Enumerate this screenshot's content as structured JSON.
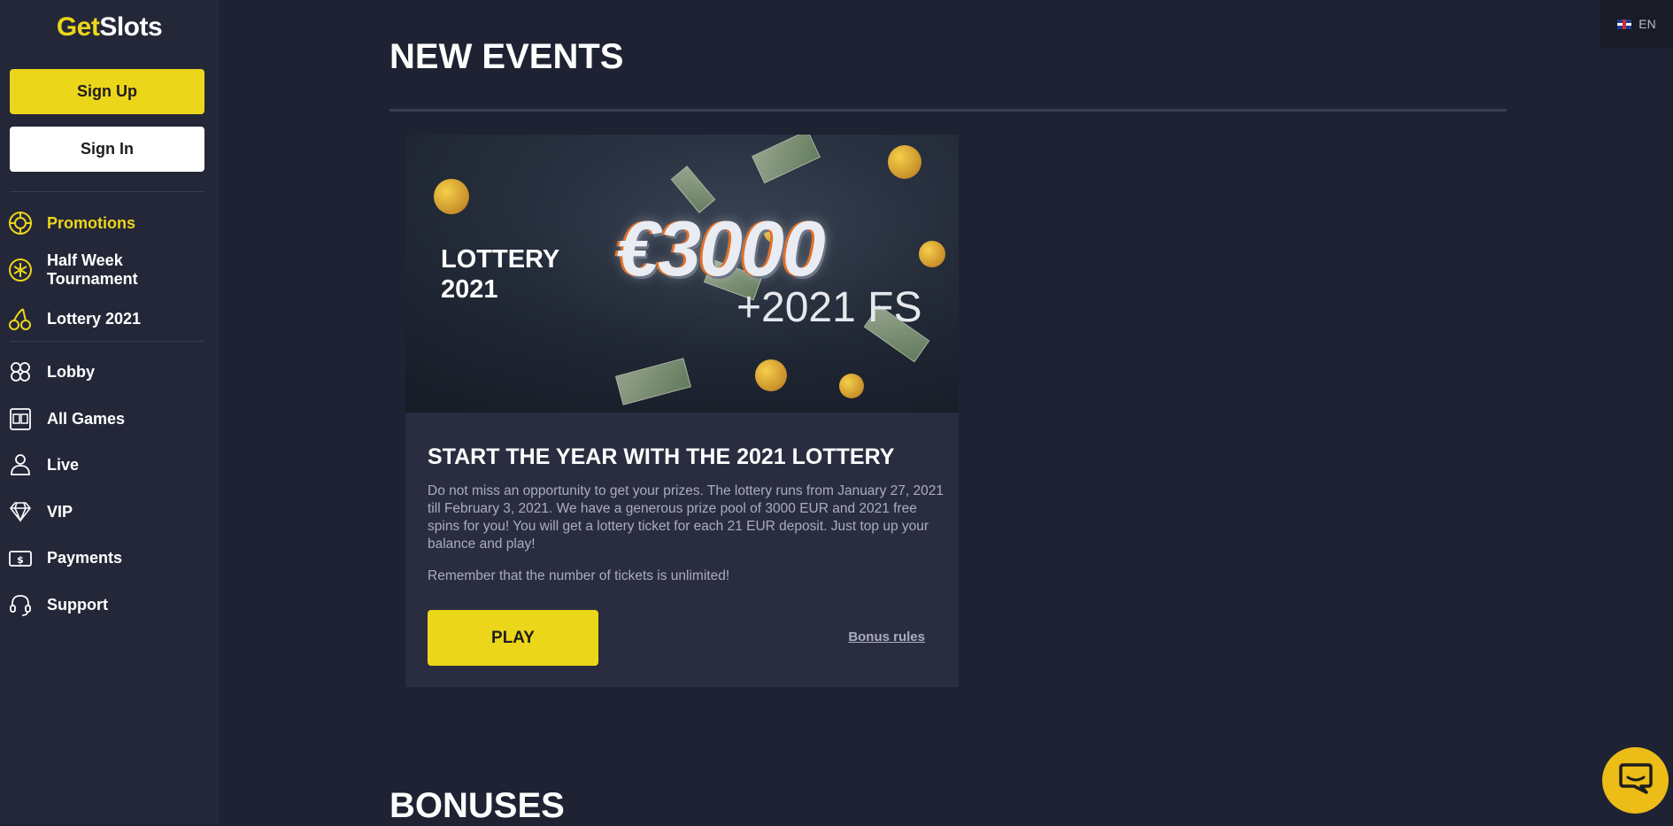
{
  "brand": {
    "part1": "Get",
    "part2": "Slots",
    "accent": "#ecd61a"
  },
  "auth": {
    "signup_label": "Sign Up",
    "signin_label": "Sign In"
  },
  "sidebar": {
    "promo_items": [
      {
        "label": "Promotions",
        "icon": "target-icon",
        "active": true
      },
      {
        "label": "Half Week Tournament",
        "icon": "snowflake-icon"
      },
      {
        "label": "Lottery 2021",
        "icon": "cherries-icon"
      }
    ],
    "items": [
      {
        "label": "Lobby",
        "icon": "clover-icon"
      },
      {
        "label": "All Games",
        "icon": "slot-machine-icon"
      },
      {
        "label": "Live",
        "icon": "dealer-icon"
      },
      {
        "label": "VIP",
        "icon": "diamond-icon"
      },
      {
        "label": "Payments",
        "icon": "money-icon"
      },
      {
        "label": "Support",
        "icon": "headset-icon"
      }
    ]
  },
  "language": {
    "code": "EN",
    "flag": "uk-flag-icon"
  },
  "main": {
    "section_new_events": "NEW EVENTS",
    "banner": {
      "title_line1": "LOTTERY",
      "title_line2": "2021",
      "amount": "€3000",
      "free_spins": "+2021 FS"
    },
    "event_card": {
      "title": "START THE YEAR WITH THE 2021 LOTTERY",
      "description": "Do not miss an opportunity to get your prizes. The lottery runs from January 27, 2021 till February 3, 2021. We have a generous prize pool of 3000 EUR and 2021 free spins for you! You will get a lottery ticket for each 21 EUR deposit. Just top up your balance and play!",
      "note": "Remember that the number of tickets is unlimited!",
      "play_label": "PLAY",
      "rules_label": "Bonus rules"
    },
    "section_bonuses": "BONUSES"
  },
  "chat": {
    "icon": "chat-bubble-icon"
  }
}
